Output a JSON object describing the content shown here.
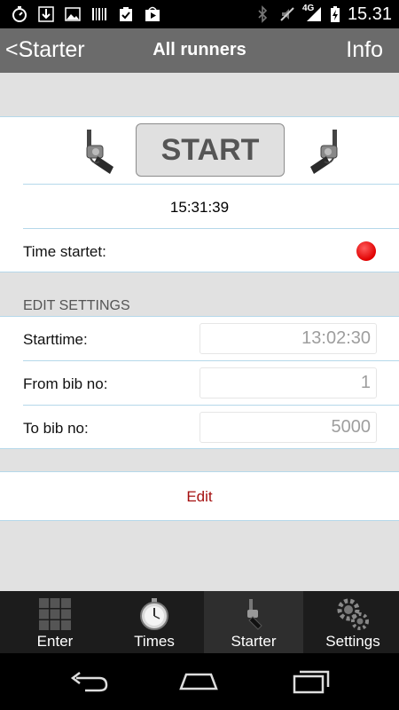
{
  "status_bar": {
    "time": "15.31",
    "network": "4G",
    "icons": [
      "stopwatch-icon",
      "download-icon",
      "image-icon",
      "barcode-icon",
      "clipboard-check-icon",
      "play-store-icon",
      "bluetooth-icon",
      "mute-icon",
      "signal-icon",
      "battery-charging-icon"
    ]
  },
  "nav": {
    "back_label": "<Starter",
    "title": "All runners",
    "info_label": "Info"
  },
  "start_panel": {
    "start_label": "START",
    "clock": "15:31:39",
    "time_started_label": "Time startet:",
    "status_color": "#ff1a1a"
  },
  "settings": {
    "header": "EDIT SETTINGS",
    "starttime_label": "Starttime:",
    "starttime_value": "13:02:30",
    "from_bib_label": "From bib no:",
    "from_bib_value": "1",
    "to_bib_label": "To bib no:",
    "to_bib_value": "5000"
  },
  "edit": {
    "label": "Edit",
    "color": "#a51010"
  },
  "tabs": [
    {
      "label": "Enter",
      "icon": "grid-icon",
      "active": false
    },
    {
      "label": "Times",
      "icon": "stopwatch-icon",
      "active": false
    },
    {
      "label": "Starter",
      "icon": "starter-pistol-icon",
      "active": true
    },
    {
      "label": "Settings",
      "icon": "gears-icon",
      "active": false
    }
  ],
  "system_nav": [
    "back-icon",
    "home-icon",
    "recent-apps-icon"
  ]
}
